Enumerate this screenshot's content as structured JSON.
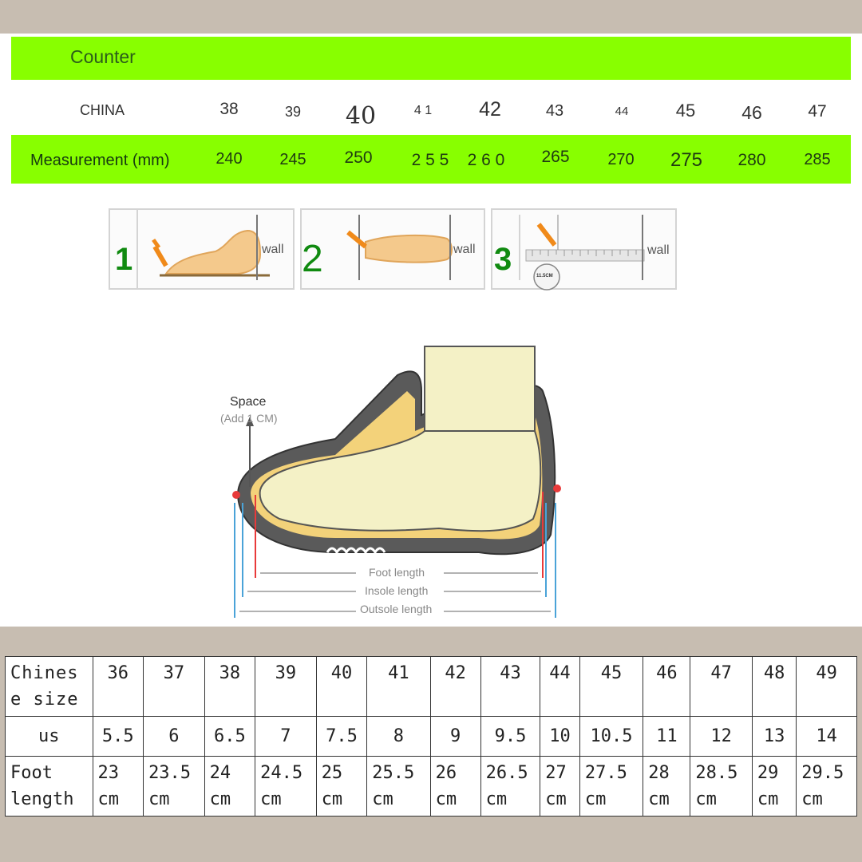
{
  "counter": {
    "title": "Counter"
  },
  "china_row": {
    "label": "CHINA",
    "sizes": [
      "38",
      "39",
      "40",
      "4 1",
      "42",
      "43",
      "44",
      "45",
      "46",
      "47"
    ]
  },
  "measure_row": {
    "label": "Measurement (mm)",
    "values": [
      "240",
      "245",
      "250",
      "2 5 5",
      "2 6 0",
      "265",
      "270",
      "275",
      "280",
      "285"
    ]
  },
  "steps": [
    {
      "number": "1",
      "wall": "wall"
    },
    {
      "number": "2",
      "wall": "wall"
    },
    {
      "number": "3",
      "wall": "wall",
      "ruler_tag": "11.5CM"
    }
  ],
  "diagram": {
    "space_label": "Space",
    "add_label": "(Add 1 CM)",
    "foot_length": "Foot length",
    "insole_length": "Insole length",
    "outsole_length": "Outsole length"
  },
  "size_table": {
    "row_labels": [
      "Chines e size",
      "us",
      "Foot length"
    ],
    "chinese_sizes": [
      "36",
      "37",
      "38",
      "39",
      "40",
      "41",
      "42",
      "43",
      "44",
      "45",
      "46",
      "47",
      "48",
      "49"
    ],
    "us_sizes": [
      "5.5",
      "6",
      "6.5",
      "7",
      "7.5",
      "8",
      "9",
      "9.5",
      "10",
      "10.5",
      "11",
      "12",
      "13",
      "14"
    ],
    "foot_lengths": [
      "23 cm",
      "23.5 cm",
      "24 cm",
      "24.5 cm",
      "25 cm",
      "25.5 cm",
      "26 cm",
      "26.5 cm",
      "27 cm",
      "27.5 cm",
      "28 cm",
      "28.5 cm",
      "29 cm",
      "29.5 cm"
    ]
  },
  "colors": {
    "green_bar": "#88ff00",
    "page_background": "#c7bdb1",
    "step_number": "#108a10",
    "marker_red": "#e83a3a"
  }
}
